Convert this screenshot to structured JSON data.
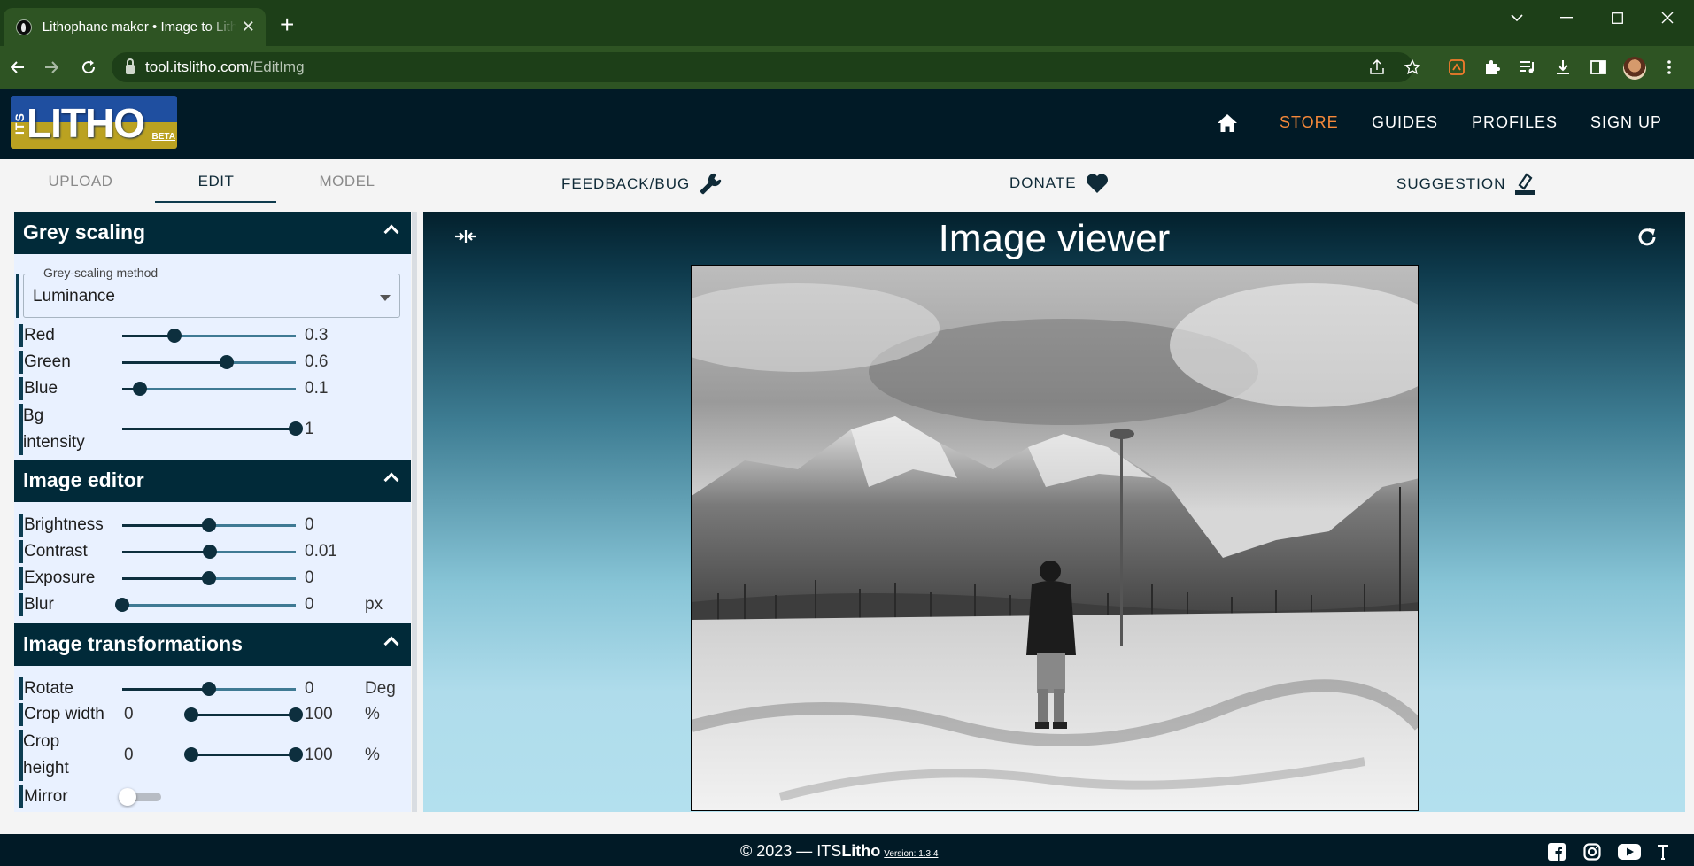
{
  "browser": {
    "tab_title": "Lithophane maker • Image to Lith",
    "new_tab": "+",
    "url_host": "tool.itslitho.com",
    "url_path": "/EditImg"
  },
  "header": {
    "logo_its": "ITS",
    "logo_litho": "LITHO",
    "logo_beta": "BETA",
    "nav": [
      "STORE",
      "GUIDES",
      "PROFILES",
      "SIGN UP"
    ],
    "accent_color": "#f6893a"
  },
  "tabs": {
    "items": [
      "UPLOAD",
      "EDIT",
      "MODEL"
    ],
    "active": "EDIT",
    "feedback": "FEEDBACK/BUG",
    "donate": "DONATE",
    "suggestion": "SUGGESTION"
  },
  "grey_scaling": {
    "title": "Grey scaling",
    "method_label": "Grey-scaling method",
    "method_value": "Luminance",
    "red": {
      "label": "Red",
      "value": "0.3",
      "fraction": 0.3
    },
    "green": {
      "label": "Green",
      "value": "0.6",
      "fraction": 0.6
    },
    "blue": {
      "label": "Blue",
      "value": "0.1",
      "fraction": 0.1
    },
    "bg": {
      "label_1": "Bg",
      "label_2": "intensity",
      "value": "1",
      "fraction": 1.0
    }
  },
  "image_editor": {
    "title": "Image editor",
    "brightness": {
      "label": "Brightness",
      "value": "0",
      "fraction": 0.5
    },
    "contrast": {
      "label": "Contrast",
      "value": "0.01",
      "fraction": 0.505
    },
    "exposure": {
      "label": "Exposure",
      "value": "0",
      "fraction": 0.5
    },
    "blur": {
      "label": "Blur",
      "value": "0",
      "unit": "px",
      "fraction": 0.0
    }
  },
  "image_transformations": {
    "title": "Image transformations",
    "rotate": {
      "label": "Rotate",
      "value": "0",
      "unit": "Deg",
      "fraction": 0.5
    },
    "crop_width": {
      "label": "Crop width",
      "min": "0",
      "max": "100",
      "unit": "%",
      "range": [
        0.4,
        1.0
      ]
    },
    "crop_height": {
      "label_1": "Crop",
      "label_2": "height",
      "min": "0",
      "max": "100",
      "unit": "%",
      "range": [
        0.4,
        1.0
      ]
    },
    "mirror": {
      "label": "Mirror",
      "on": false
    }
  },
  "viewer": {
    "title": "Image viewer"
  },
  "footer": {
    "copyright": "© 2023 — ITS",
    "brand_bold": "Litho",
    "version": "Version: 1.3.4"
  }
}
